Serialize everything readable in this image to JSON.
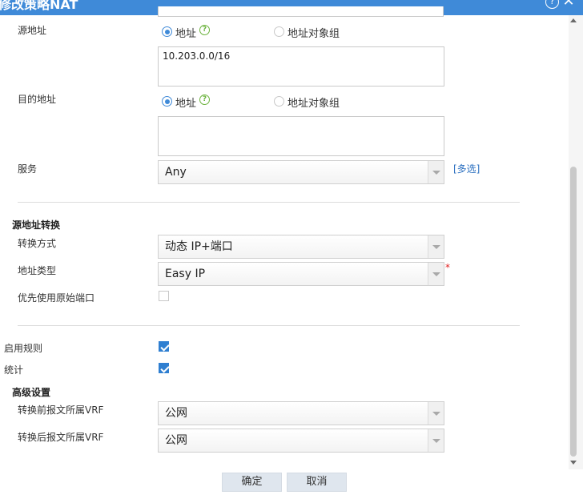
{
  "dialog": {
    "title": "修改策略NAT",
    "help_glyph": "?",
    "close_glyph": "✕"
  },
  "source_address": {
    "label": "源地址",
    "option_address": "地址",
    "option_group": "地址对象组",
    "selected": "地址",
    "value": "10.203.0.0/16",
    "help_glyph": "?"
  },
  "dest_address": {
    "label": "目的地址",
    "option_address": "地址",
    "option_group": "地址对象组",
    "selected": "地址",
    "value": "",
    "help_glyph": "?"
  },
  "service": {
    "label": "服务",
    "value": "Any",
    "multi_select_link": "[多选]"
  },
  "source_nat": {
    "section_title": "源地址转换",
    "mode_label": "转换方式",
    "mode_value": "动态 IP+端口",
    "addr_type_label": "地址类型",
    "addr_type_value": "Easy IP",
    "required_mark": "*",
    "prefer_original_port_label": "优先使用原始端口",
    "prefer_original_port_checked": false
  },
  "enable_rule": {
    "label": "启用规则",
    "checked": true
  },
  "statistics": {
    "label": "统计",
    "checked": true
  },
  "advanced": {
    "section_title": "高级设置",
    "vrf_before_label": "转换前报文所属VRF",
    "vrf_before_value": "公网",
    "vrf_after_label": "转换后报文所属VRF",
    "vrf_after_value": "公网"
  },
  "footer": {
    "ok_label": "确定",
    "cancel_label": "取消"
  },
  "colors": {
    "title_bar": "#3f8ad8",
    "checkbox_checked": "#2f7fd1",
    "help_icon": "#6cb33e",
    "link": "#2a6fc0",
    "required": "#e02020",
    "button_bg": "#dfe6ee"
  }
}
